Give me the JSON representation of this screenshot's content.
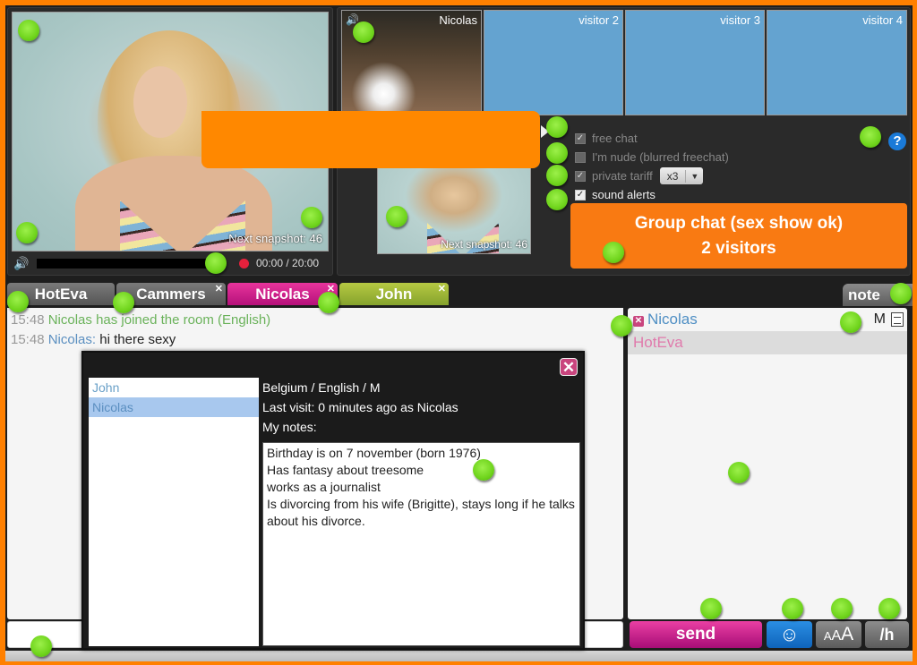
{
  "main_video": {
    "snapshot_label": "Next snapshot: 46",
    "time_display": "00:00 / 20:00",
    "progress_fraction": 0.0,
    "speaker_icon": "speaker-icon",
    "record_icon": "record-dot-icon"
  },
  "cams": [
    {
      "label": "Nicolas",
      "has_video": true,
      "speaker_icon": "speaker-icon"
    },
    {
      "label": "visitor 2",
      "has_video": false
    },
    {
      "label": "visitor 3",
      "has_video": false
    },
    {
      "label": "visitor 4",
      "has_video": false
    }
  ],
  "snapshot_thumb": {
    "label": "Next snapshot: 46"
  },
  "options": {
    "free_chat": {
      "label": "free chat",
      "checked": true,
      "disabled": true
    },
    "nude": {
      "label": "I'm nude (blurred freechat)",
      "checked": false,
      "disabled": true
    },
    "private_tariff": {
      "label": "private tariff",
      "checked": true,
      "disabled": true,
      "value": "x3"
    },
    "sound_alerts": {
      "label": "sound alerts",
      "checked": true,
      "disabled": false
    },
    "help_label": "?"
  },
  "group_chat": {
    "line1": "Group chat (sex show ok)",
    "line2": "2 visitors"
  },
  "tabs": [
    {
      "label": "HotEva",
      "closable": false,
      "color": "#666666"
    },
    {
      "label": "Cammers",
      "closable": true,
      "color": "#666666"
    },
    {
      "label": "Nicolas",
      "closable": true,
      "color": "#d61f8c"
    },
    {
      "label": "John",
      "closable": true,
      "color": "#9bb737"
    }
  ],
  "notes_tab": {
    "label": "note"
  },
  "chat": {
    "lines": [
      {
        "time": "15:48",
        "user": "",
        "text": "Nicolas has joined the room (English)",
        "type": "system"
      },
      {
        "time": "15:48",
        "user": "Nicolas:",
        "text": "hi there sexy",
        "type": "message"
      }
    ]
  },
  "user_list": [
    {
      "name": "Nicolas",
      "gender": "M",
      "kickable": true,
      "has_note": true,
      "color": "#4f8fc4"
    },
    {
      "name": "HotEva",
      "gender": "",
      "kickable": false,
      "has_note": false,
      "color": "#e07aac"
    }
  ],
  "input": {
    "value": "",
    "placeholder": ""
  },
  "buttons": {
    "send": "send",
    "emoji": "☺",
    "font_a1": "A",
    "font_a2": "A",
    "font_a3": "A",
    "history": "/h"
  },
  "notes_dialog": {
    "close_label": "✕",
    "users": [
      "John",
      "Nicolas"
    ],
    "selected_user": "Nicolas",
    "info_line1": "Belgium / English / M",
    "info_line2": "Last visit: 0 minutes ago as Nicolas",
    "notes_label": "My notes:",
    "notes_text": "Birthday is on 7 november (born 1976)\nHas fantasy about treesome\nworks as a journalist\nIs divorcing from his wife (Brigitte), stays long if he talks about his divorce."
  },
  "colors": {
    "frame": "#ff8000",
    "accent_orange": "#f97a12",
    "send_pink": "#d61f8c",
    "emoji_blue": "#1a7ad8",
    "empty_cam": "#64a3d0"
  }
}
